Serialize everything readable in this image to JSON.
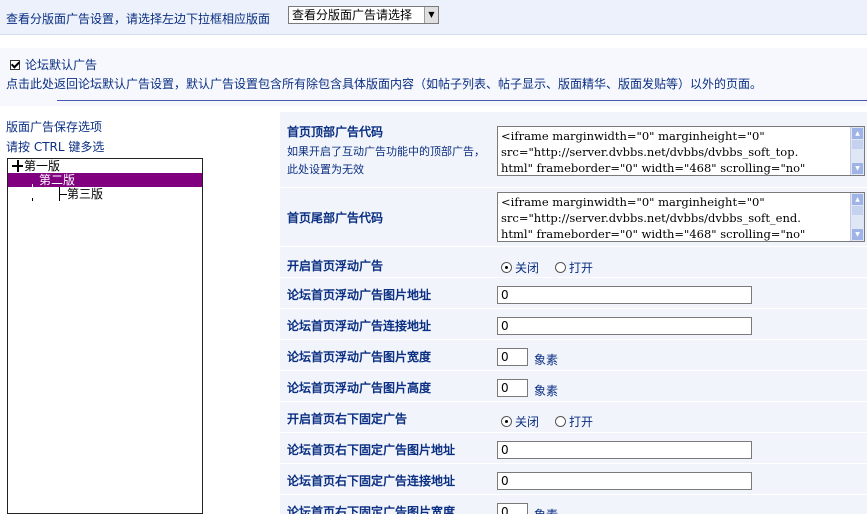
{
  "header": {
    "hint": "查看分版面广告设置，请选择左边下拉框相应版面",
    "board_select_value": "查看分版面广告请选择"
  },
  "default_ad": {
    "checkbox_label": "论坛默认广告",
    "description": "点击此处返回论坛默认广告设置，默认广告设置包含所有除包含具体版面内容（如帖子列表、帖子显示、版面精华、版面发贴等）以外的页面。"
  },
  "sidebar": {
    "title": "版面广告保存选项",
    "subtitle": "请按 CTRL 键多选",
    "boards": [
      "第一版",
      "第二版",
      "第三版"
    ],
    "selected_index": 1
  },
  "form": {
    "top_ad": {
      "label": "首页顶部广告代码",
      "note": "如果开启了互动广告功能中的顶部广告，此处设置为无效",
      "lines": [
        "<iframe marginwidth=\"0\" marginheight=\"0\"",
        "src=\"http://server.dvbbs.net/dvbbs/dvbbs_soft_top.",
        "html\" frameborder=\"0\" width=\"468\" scrolling=\"no\""
      ]
    },
    "bottom_ad": {
      "label": "首页尾部广告代码",
      "lines": [
        "<iframe marginwidth=\"0\" marginheight=\"0\"",
        "src=\"http://server.dvbbs.net/dvbbs/dvbbs_soft_end.",
        "html\" frameborder=\"0\" width=\"468\" scrolling=\"no\""
      ]
    },
    "float_ad_toggle": {
      "label": "开启首页浮动广告",
      "off": "关闭",
      "on": "打开"
    },
    "float_img_url": {
      "label": "论坛首页浮动广告图片地址",
      "value": "0"
    },
    "float_link_url": {
      "label": "论坛首页浮动广告连接地址",
      "value": "0"
    },
    "float_img_width": {
      "label": "论坛首页浮动广告图片宽度",
      "value": "0",
      "unit": "象素"
    },
    "float_img_height": {
      "label": "论坛首页浮动广告图片高度",
      "value": "0",
      "unit": "象素"
    },
    "fixed_ad_toggle": {
      "label": "开启首页右下固定广告",
      "off": "关闭",
      "on": "打开"
    },
    "fixed_img_url": {
      "label": "论坛首页右下固定广告图片地址",
      "value": "0"
    },
    "fixed_link_url": {
      "label": "论坛首页右下固定广告连接地址",
      "value": "0"
    },
    "fixed_img_width": {
      "label": "论坛首页右下固定广告图片宽度",
      "value": "0",
      "unit": "象素"
    }
  }
}
